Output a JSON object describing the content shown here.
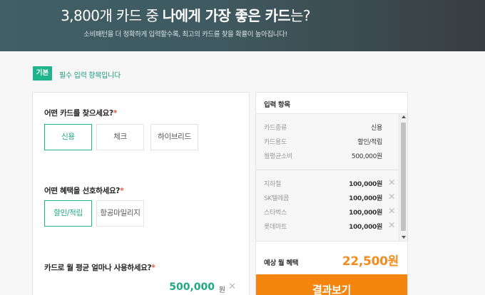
{
  "header": {
    "title_prefix": "3,800개 카드 중 ",
    "title_bold": "나에게 가장 좋은 카드",
    "title_suffix": "는?",
    "subtitle": "소비패턴을 더 정확하게 입력할수록, 최고의 카드를 찾을 확률이 높아집니다!"
  },
  "section": {
    "tag": "기본",
    "text": "필수 입력 항목입니다"
  },
  "form": {
    "q1": {
      "label": "어떤 카드를 찾으세요?",
      "required_mark": "*",
      "options": [
        "신용",
        "체크",
        "하이브리드"
      ],
      "selected": "신용"
    },
    "q2": {
      "label": "어떤 혜택을 선호하세요?",
      "required_mark": "*",
      "options": [
        "할인/적립",
        "항공마일리지"
      ],
      "selected": "할인/적립"
    },
    "q3": {
      "label": "카드로 월 평균 얼마나 사용하세요?",
      "required_mark": "*",
      "amount": "500,000",
      "unit": "원",
      "clear": "✕"
    }
  },
  "summary": {
    "title": "입력 항목",
    "basic": [
      {
        "key": "카드종류",
        "value": "신용"
      },
      {
        "key": "카드용도",
        "value": "할인/적립"
      },
      {
        "key": "월평균소비",
        "value": "500,000원"
      }
    ],
    "spending": [
      {
        "key": "지하철",
        "value": "100,000원"
      },
      {
        "key": "SK텔레콤",
        "value": "100,000원"
      },
      {
        "key": "스타벅스",
        "value": "100,000원"
      },
      {
        "key": "롯데마트",
        "value": "100,000원"
      }
    ],
    "remove": "✕",
    "benefit_label": "예상 월 혜택",
    "benefit_value": "22,500원"
  },
  "result_button": "결과보기",
  "colors": {
    "accent_green": "#1fb48b",
    "accent_orange": "#f4850f",
    "benefit_orange": "#f28c1f"
  }
}
